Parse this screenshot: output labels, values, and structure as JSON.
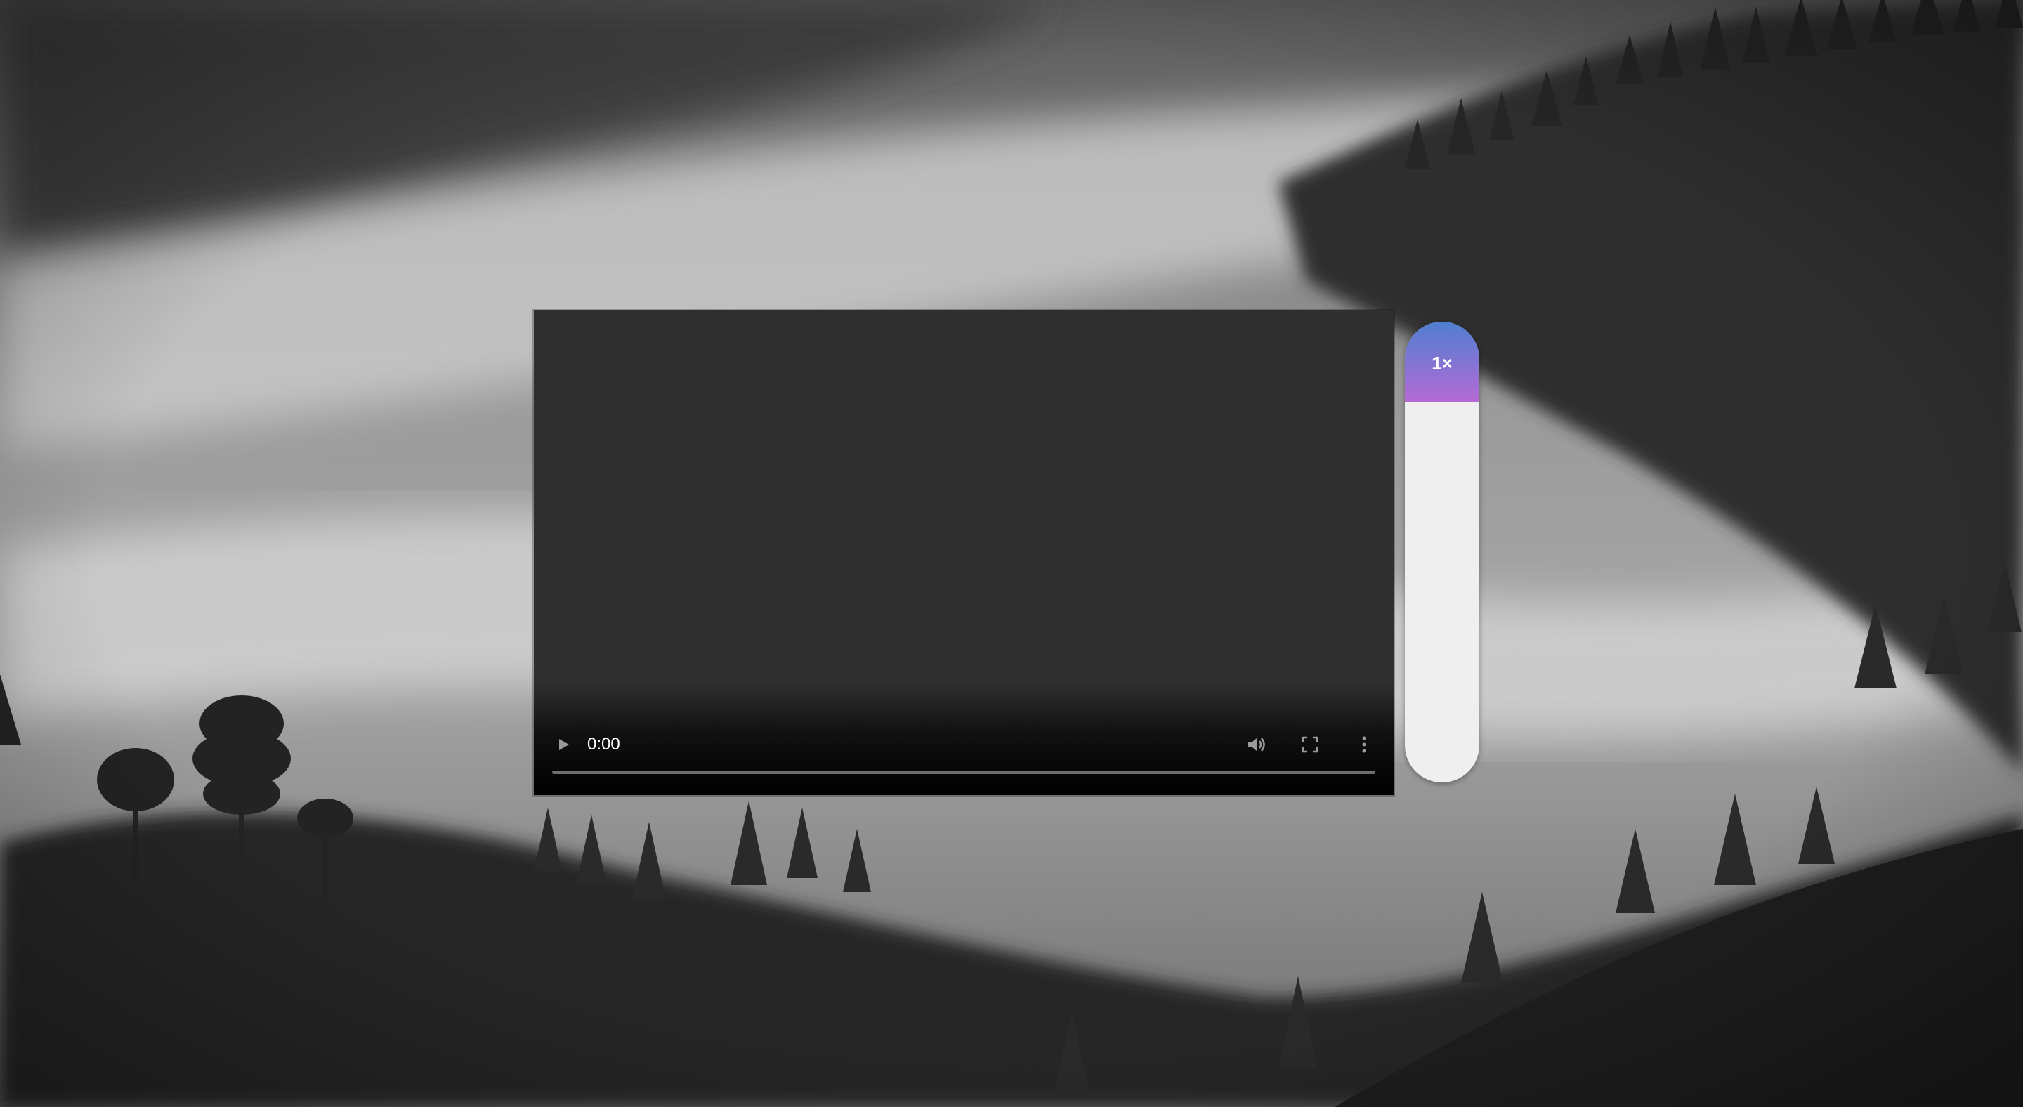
{
  "background": {
    "scene": "misty-forest-monochrome"
  },
  "video_player": {
    "time": "0:00",
    "progress": 0,
    "icons": {
      "play": "play-icon",
      "volume": "volume-icon",
      "fullscreen": "fullscreen-icon",
      "more": "more-options-icon"
    }
  },
  "speed_control": {
    "label": "1×",
    "colors": {
      "gradient_top": "#4f7fd0",
      "gradient_bottom": "#b56ad6",
      "track": "#efefef"
    }
  }
}
